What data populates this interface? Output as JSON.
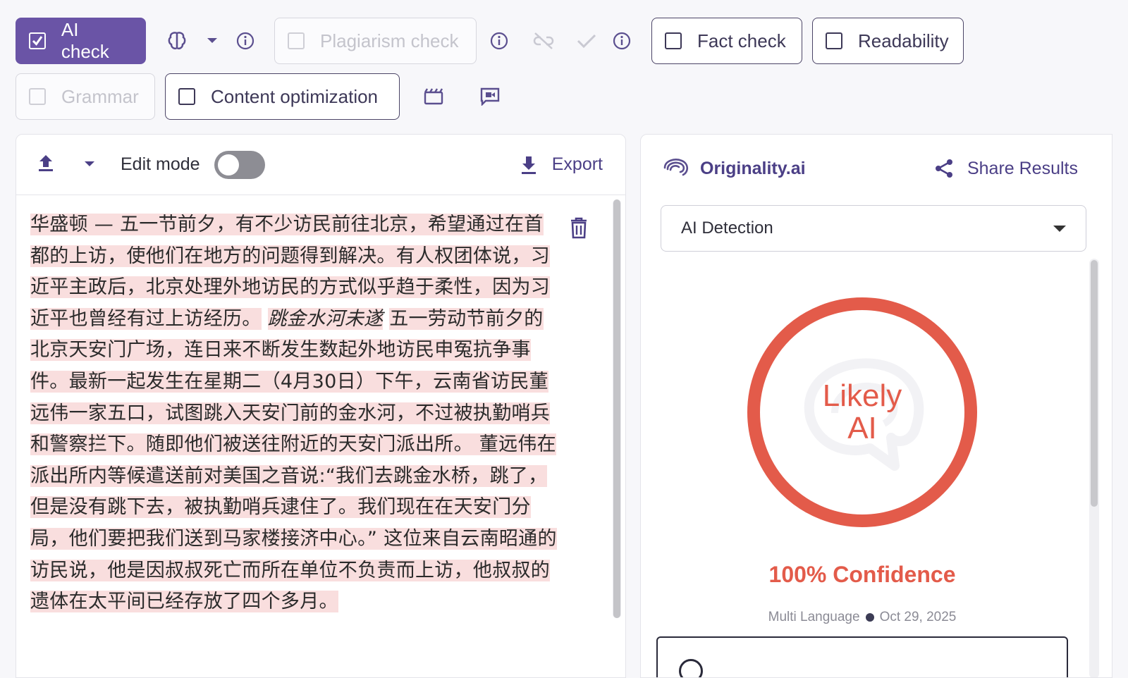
{
  "toolbar": {
    "ai_check": "AI check",
    "plagiarism_check": "Plagiarism check",
    "fact_check": "Fact check",
    "readability": "Readability",
    "grammar": "Grammar",
    "content_optimization": "Content optimization"
  },
  "editor": {
    "edit_mode_label": "Edit mode",
    "edit_mode_on": false,
    "export_label": "Export",
    "paragraph_parts": [
      "华盛顿 — 五一节前夕，有不少访民前往北京，希望通过在首都的上访，使他们在地方的问题得到解决。有人权团体说，习近平主政后，北京处理外地访民的方式似乎趋于柔性，因为习近平也曾经有过上访经历。",
      "跳金水河未遂",
      "五一劳动节前夕的北京天安门广场，连日来不断发生数起外地访民申冤抗争事件。最新一起发生在星期二（4月30日）下午，云南省访民董远伟一家五口，试图跳入天安门前的金水河，不过被执勤哨兵和警察拦下。随即他们被送往附近的天安门派出所。 董远伟在派出所内等候遣送前对美国之音说:“我们去跳金水桥，跳了，但是没有跳下去，被执勤哨兵逮住了。我们现在在天安门分局，他们要把我们送到马家楼接济中心。” 这位来自云南昭通的访民说，他是因叔叔死亡而所在单位不负责而上访，他叔叔的遗体在太平间已经存放了四个多月。"
    ]
  },
  "results": {
    "brand": "Originality.ai",
    "share_label": "Share Results",
    "detection_select": "AI Detection",
    "verdict_line1": "Likely",
    "verdict_line2": "AI",
    "confidence": "100% Confidence",
    "language": "Multi Language",
    "date": "Oct 29, 2025",
    "accent_color": "#e35b4a",
    "brand_color": "#6a54a6"
  }
}
